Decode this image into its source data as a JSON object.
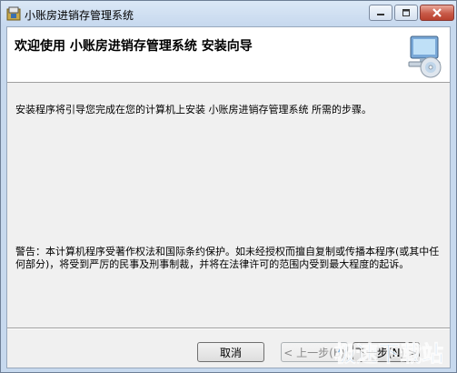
{
  "window": {
    "title": "小账房进销存管理系统",
    "icons": {
      "app": "setup-icon",
      "minimize": "minimize-icon",
      "maximize": "maximize-icon",
      "close": "close-icon"
    }
  },
  "banner": {
    "title": "欢迎使用  小账房进销存管理系统  安装向导",
    "icon": "computer-cd-icon"
  },
  "intro_text": "安装程序将引导您完成在您的计算机上安装 小账房进销存管理系统 所需的步骤。",
  "warning_text": "警告：本计算机程序受著作权法和国际条约保护。如未经授权而擅自复制或传播本程序(或其中任何部分)，将受到严厉的民事及刑事制裁，并将在法律许可的范围内受到最大程度的起诉。",
  "buttons": {
    "cancel": "取消",
    "back": "< 上一步(B)",
    "next": "下一步(N) >"
  },
  "watermark": {
    "text": "极速下载站",
    "color": "#1e7fd8"
  }
}
